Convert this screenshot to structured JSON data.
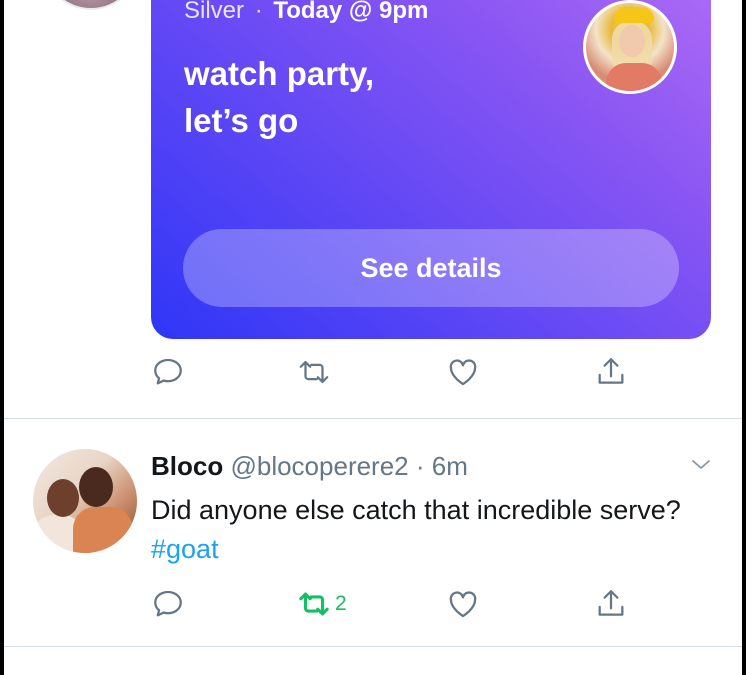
{
  "event_card": {
    "host_name": "Silver",
    "separator": "·",
    "when": "Today @ 9pm",
    "title_lines": [
      "watch party,",
      "let’s go"
    ],
    "button_label": "See details"
  },
  "tweet": {
    "display_name": "Bloco",
    "handle": "@blocoperere2",
    "separator": "·",
    "time": "6m",
    "text": "Did anyone else catch that incredible serve? ",
    "hashtag": "#goat",
    "retweet_count": "2"
  },
  "icons": {
    "reply": "reply-icon",
    "retweet": "retweet-icon",
    "like": "heart-icon",
    "share": "share-icon",
    "menu": "chevron-down-icon"
  },
  "colors": {
    "accent": "#1da1f2",
    "retweeted": "#17bf63",
    "icon_gray": "#657786",
    "card_gradient_start": "#2f36f7",
    "card_gradient_end": "#b06cf6"
  }
}
